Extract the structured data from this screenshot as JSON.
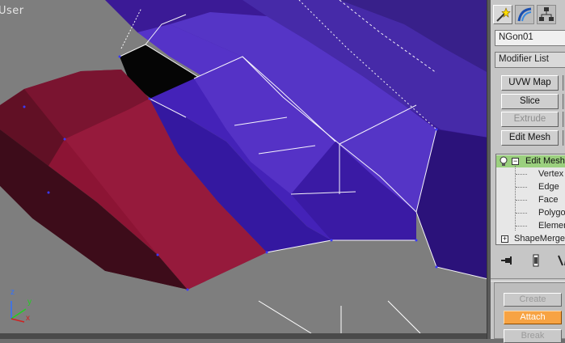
{
  "viewport": {
    "label": "User",
    "colors": {
      "background": "#7e7e7e",
      "blue_surface": "#3d1f9a",
      "red_surface": "#8a1530",
      "edge": "#ffffff",
      "vertex": "#3a3aff"
    },
    "axis_labels": {
      "y": "y",
      "x": "x",
      "z": "z"
    }
  },
  "command_panel": {
    "tabs": [
      {
        "name": "create",
        "icon": "star-wand-icon"
      },
      {
        "name": "modify",
        "icon": "modify-arc-icon"
      },
      {
        "name": "hierarchy",
        "icon": "hierarchy-icon"
      }
    ],
    "object_name": "NGon01",
    "modifier_list": "Modifier List",
    "buttons": [
      {
        "label": "UVW Map",
        "enabled": true
      },
      {
        "label": "Slice",
        "enabled": true
      },
      {
        "label": "Extrude",
        "enabled": false
      },
      {
        "label": "Edit Mesh",
        "enabled": true
      }
    ],
    "modifier_stack": {
      "top": "Edit Mesh",
      "sub_objects": [
        "Vertex",
        "Edge",
        "Face",
        "Polygon",
        "Element"
      ],
      "base": "ShapeMerge"
    },
    "stack_tools": [
      {
        "name": "pin-stack",
        "icon": "pin-icon"
      },
      {
        "name": "show-end-result",
        "icon": "end-result-icon"
      },
      {
        "name": "make-unique",
        "icon": "make-unique-icon"
      }
    ],
    "rollout": {
      "buttons": [
        {
          "label": "Create",
          "state": "disabled"
        },
        {
          "label": "Attach",
          "state": "active"
        },
        {
          "label": "Break",
          "state": "disabled"
        }
      ]
    }
  }
}
